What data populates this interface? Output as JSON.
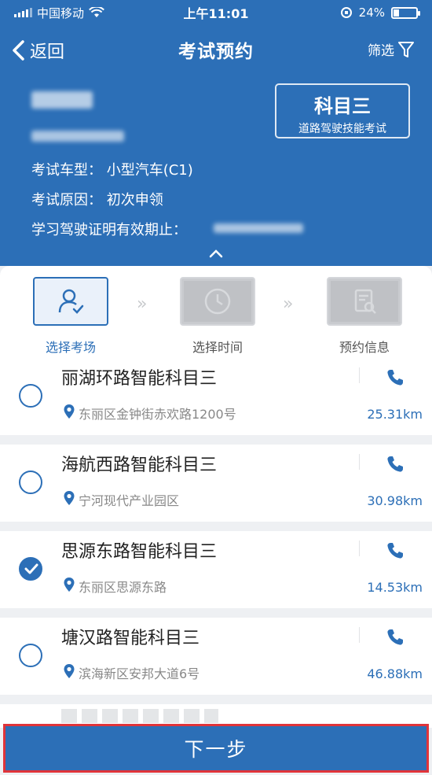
{
  "status_bar": {
    "carrier": "中国移动",
    "time": "上午11:01",
    "battery": "24%"
  },
  "nav": {
    "back_label": "返回",
    "title": "考试预约",
    "filter_label": "筛选"
  },
  "info": {
    "subject": "科目三",
    "subject_desc": "道路驾驶技能考试",
    "vehicle_type": "考试车型：  小型汽车(C1)",
    "reason": "考试原因：  初次申领",
    "permit_expiry": "学习驾驶证明有效期止："
  },
  "steps": [
    {
      "label": "选择考场",
      "active": true
    },
    {
      "label": "选择时间",
      "active": false
    },
    {
      "label": "预约信息",
      "active": false
    }
  ],
  "venues": [
    {
      "name": "丽湖环路智能科目三",
      "address": "东丽区金钟街赤欢路1200号",
      "distance": "25.31km",
      "selected": false
    },
    {
      "name": "海航西路智能科目三",
      "address": "宁河现代产业园区",
      "distance": "30.98km",
      "selected": false
    },
    {
      "name": "思源东路智能科目三",
      "address": "东丽区思源东路",
      "distance": "14.53km",
      "selected": true
    },
    {
      "name": "塘汉路智能科目三",
      "address": "滨海新区安邦大道6号",
      "distance": "46.88km",
      "selected": false
    }
  ],
  "next_button": "下一步",
  "colors": {
    "primary": "#2c6fb7",
    "highlight_border": "#e0343a"
  }
}
